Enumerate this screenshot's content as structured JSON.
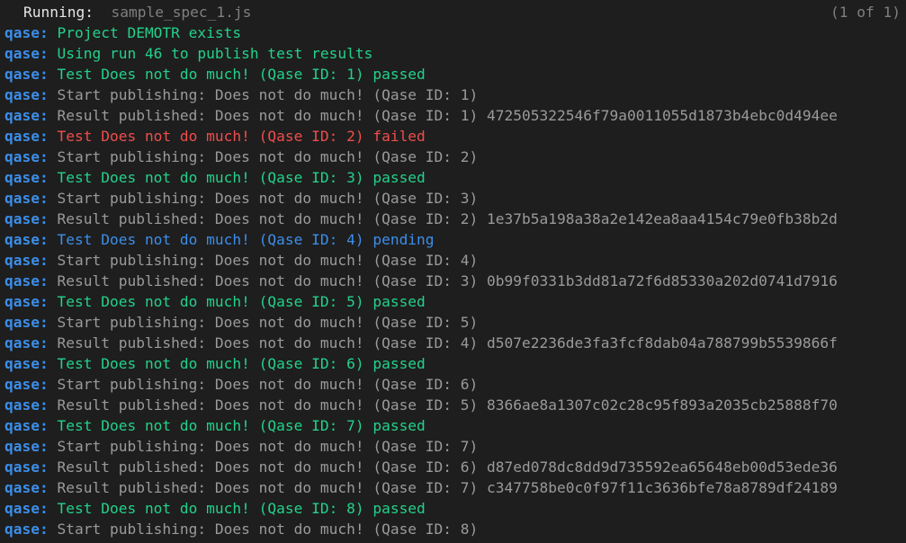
{
  "header": {
    "running_label": "Running:",
    "spec_name": "sample_spec_1.js",
    "counter": "(1 of 1)"
  },
  "colors": {
    "background": "#1e1e1e",
    "prefix": "#3b8eea",
    "passed": "#23d18b",
    "failed": "#f14c4c",
    "pending": "#3b8eea",
    "info": "#9a9a9a"
  },
  "log": [
    {
      "prefix": "qase:",
      "text": "Project DEMOTR exists",
      "kind": "green"
    },
    {
      "prefix": "qase:",
      "text": "Using run 46 to publish test results",
      "kind": "green"
    },
    {
      "prefix": "qase:",
      "text": "Test Does not do much! (Qase ID: 1) passed",
      "kind": "green"
    },
    {
      "prefix": "qase:",
      "text": "Start publishing: Does not do much! (Qase ID: 1)",
      "kind": "gray"
    },
    {
      "prefix": "qase:",
      "text": "Result published: Does not do much! (Qase ID: 1) 472505322546f79a0011055d1873b4ebc0d494ee",
      "kind": "gray"
    },
    {
      "prefix": "qase:",
      "text": "Test Does not do much! (Qase ID: 2) failed",
      "kind": "red"
    },
    {
      "prefix": "qase:",
      "text": "Start publishing: Does not do much! (Qase ID: 2)",
      "kind": "gray"
    },
    {
      "prefix": "qase:",
      "text": "Test Does not do much! (Qase ID: 3) passed",
      "kind": "green"
    },
    {
      "prefix": "qase:",
      "text": "Start publishing: Does not do much! (Qase ID: 3)",
      "kind": "gray"
    },
    {
      "prefix": "qase:",
      "text": "Result published: Does not do much! (Qase ID: 2) 1e37b5a198a38a2e142ea8aa4154c79e0fb38b2d",
      "kind": "gray"
    },
    {
      "prefix": "qase:",
      "text": "Test Does not do much! (Qase ID: 4) pending",
      "kind": "blue"
    },
    {
      "prefix": "qase:",
      "text": "Start publishing: Does not do much! (Qase ID: 4)",
      "kind": "gray"
    },
    {
      "prefix": "qase:",
      "text": "Result published: Does not do much! (Qase ID: 3) 0b99f0331b3dd81a72f6d85330a202d0741d7916",
      "kind": "gray"
    },
    {
      "prefix": "qase:",
      "text": "Test Does not do much! (Qase ID: 5) passed",
      "kind": "green"
    },
    {
      "prefix": "qase:",
      "text": "Start publishing: Does not do much! (Qase ID: 5)",
      "kind": "gray"
    },
    {
      "prefix": "qase:",
      "text": "Result published: Does not do much! (Qase ID: 4) d507e2236de3fa3fcf8dab04a788799b5539866f",
      "kind": "gray"
    },
    {
      "prefix": "qase:",
      "text": "Test Does not do much! (Qase ID: 6) passed",
      "kind": "green"
    },
    {
      "prefix": "qase:",
      "text": "Start publishing: Does not do much! (Qase ID: 6)",
      "kind": "gray"
    },
    {
      "prefix": "qase:",
      "text": "Result published: Does not do much! (Qase ID: 5) 8366ae8a1307c02c28c95f893a2035cb25888f70",
      "kind": "gray"
    },
    {
      "prefix": "qase:",
      "text": "Test Does not do much! (Qase ID: 7) passed",
      "kind": "green"
    },
    {
      "prefix": "qase:",
      "text": "Start publishing: Does not do much! (Qase ID: 7)",
      "kind": "gray"
    },
    {
      "prefix": "qase:",
      "text": "Result published: Does not do much! (Qase ID: 6) d87ed078dc8dd9d735592ea65648eb00d53ede36",
      "kind": "gray"
    },
    {
      "prefix": "qase:",
      "text": "Result published: Does not do much! (Qase ID: 7) c347758be0c0f97f11c3636bfe78a8789df24189",
      "kind": "gray"
    },
    {
      "prefix": "qase:",
      "text": "Test Does not do much! (Qase ID: 8) passed",
      "kind": "green"
    },
    {
      "prefix": "qase:",
      "text": "Start publishing: Does not do much! (Qase ID: 8)",
      "kind": "gray"
    }
  ]
}
